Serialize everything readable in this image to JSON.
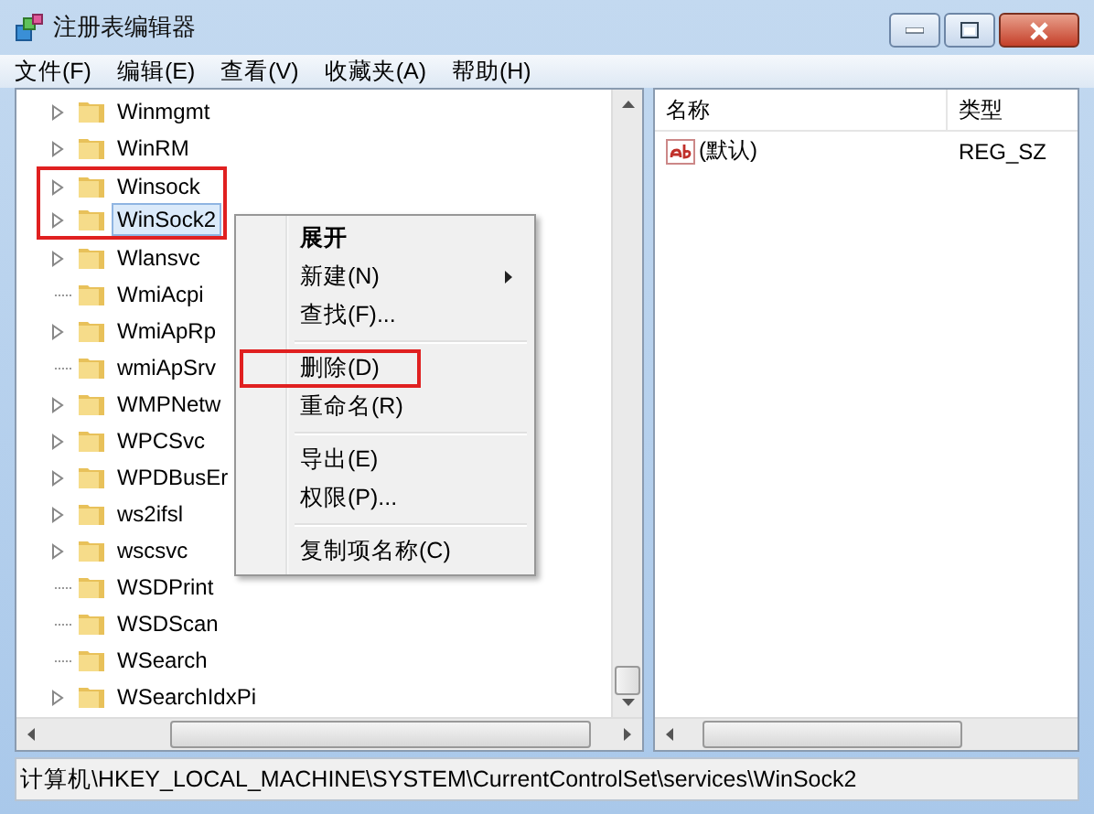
{
  "window": {
    "title": "注册表编辑器"
  },
  "menu_bar": [
    "文件(F)",
    "编辑(E)",
    "查看(V)",
    "收藏夹(A)",
    "帮助(H)"
  ],
  "tree": {
    "items": [
      {
        "label": "Winmgmt",
        "expandable": true,
        "selected": false,
        "boxed": false
      },
      {
        "label": "WinRM",
        "expandable": true,
        "selected": false,
        "boxed": false
      },
      {
        "label": "Winsock",
        "expandable": true,
        "selected": false,
        "boxed": true
      },
      {
        "label": "WinSock2",
        "expandable": true,
        "selected": true,
        "boxed": true
      },
      {
        "label": "Wlansvc",
        "expandable": true,
        "selected": false,
        "boxed": false
      },
      {
        "label": "WmiAcpi",
        "expandable": false,
        "selected": false,
        "boxed": false
      },
      {
        "label": "WmiApRp",
        "expandable": true,
        "selected": false,
        "boxed": false
      },
      {
        "label": "wmiApSrv",
        "expandable": false,
        "selected": false,
        "boxed": false
      },
      {
        "label": "WMPNetw",
        "expandable": true,
        "selected": false,
        "boxed": false
      },
      {
        "label": "WPCSvc",
        "expandable": true,
        "selected": false,
        "boxed": false
      },
      {
        "label": "WPDBusEr",
        "expandable": true,
        "selected": false,
        "boxed": false
      },
      {
        "label": "ws2ifsl",
        "expandable": true,
        "selected": false,
        "boxed": false
      },
      {
        "label": "wscsvc",
        "expandable": true,
        "selected": false,
        "boxed": false
      },
      {
        "label": "WSDPrint",
        "expandable": false,
        "selected": false,
        "boxed": false
      },
      {
        "label": "WSDScan",
        "expandable": false,
        "selected": false,
        "boxed": false
      },
      {
        "label": "WSearch",
        "expandable": false,
        "selected": false,
        "boxed": false
      },
      {
        "label": "WSearchIdxPi",
        "expandable": true,
        "selected": false,
        "boxed": false
      }
    ]
  },
  "context_menu": {
    "items": [
      {
        "kind": "item",
        "label": "展开",
        "default": true,
        "submenu": false,
        "boxed": false
      },
      {
        "kind": "item",
        "label": "新建(N)",
        "default": false,
        "submenu": true,
        "boxed": false
      },
      {
        "kind": "item",
        "label": "查找(F)...",
        "default": false,
        "submenu": false,
        "boxed": false
      },
      {
        "kind": "separator"
      },
      {
        "kind": "item",
        "label": "删除(D)",
        "default": false,
        "submenu": false,
        "boxed": true
      },
      {
        "kind": "item",
        "label": "重命名(R)",
        "default": false,
        "submenu": false,
        "boxed": false
      },
      {
        "kind": "separator"
      },
      {
        "kind": "item",
        "label": "导出(E)",
        "default": false,
        "submenu": false,
        "boxed": false
      },
      {
        "kind": "item",
        "label": "权限(P)...",
        "default": false,
        "submenu": false,
        "boxed": false
      },
      {
        "kind": "separator"
      },
      {
        "kind": "item",
        "label": "复制项名称(C)",
        "default": false,
        "submenu": false,
        "boxed": false
      }
    ]
  },
  "values": {
    "columns": [
      "名称",
      "类型"
    ],
    "rows": [
      {
        "name": "(默认)",
        "type": "REG_SZ"
      }
    ]
  },
  "status_bar": "计算机\\HKEY_LOCAL_MACHINE\\SYSTEM\\CurrentControlSet\\services\\WinSock2"
}
